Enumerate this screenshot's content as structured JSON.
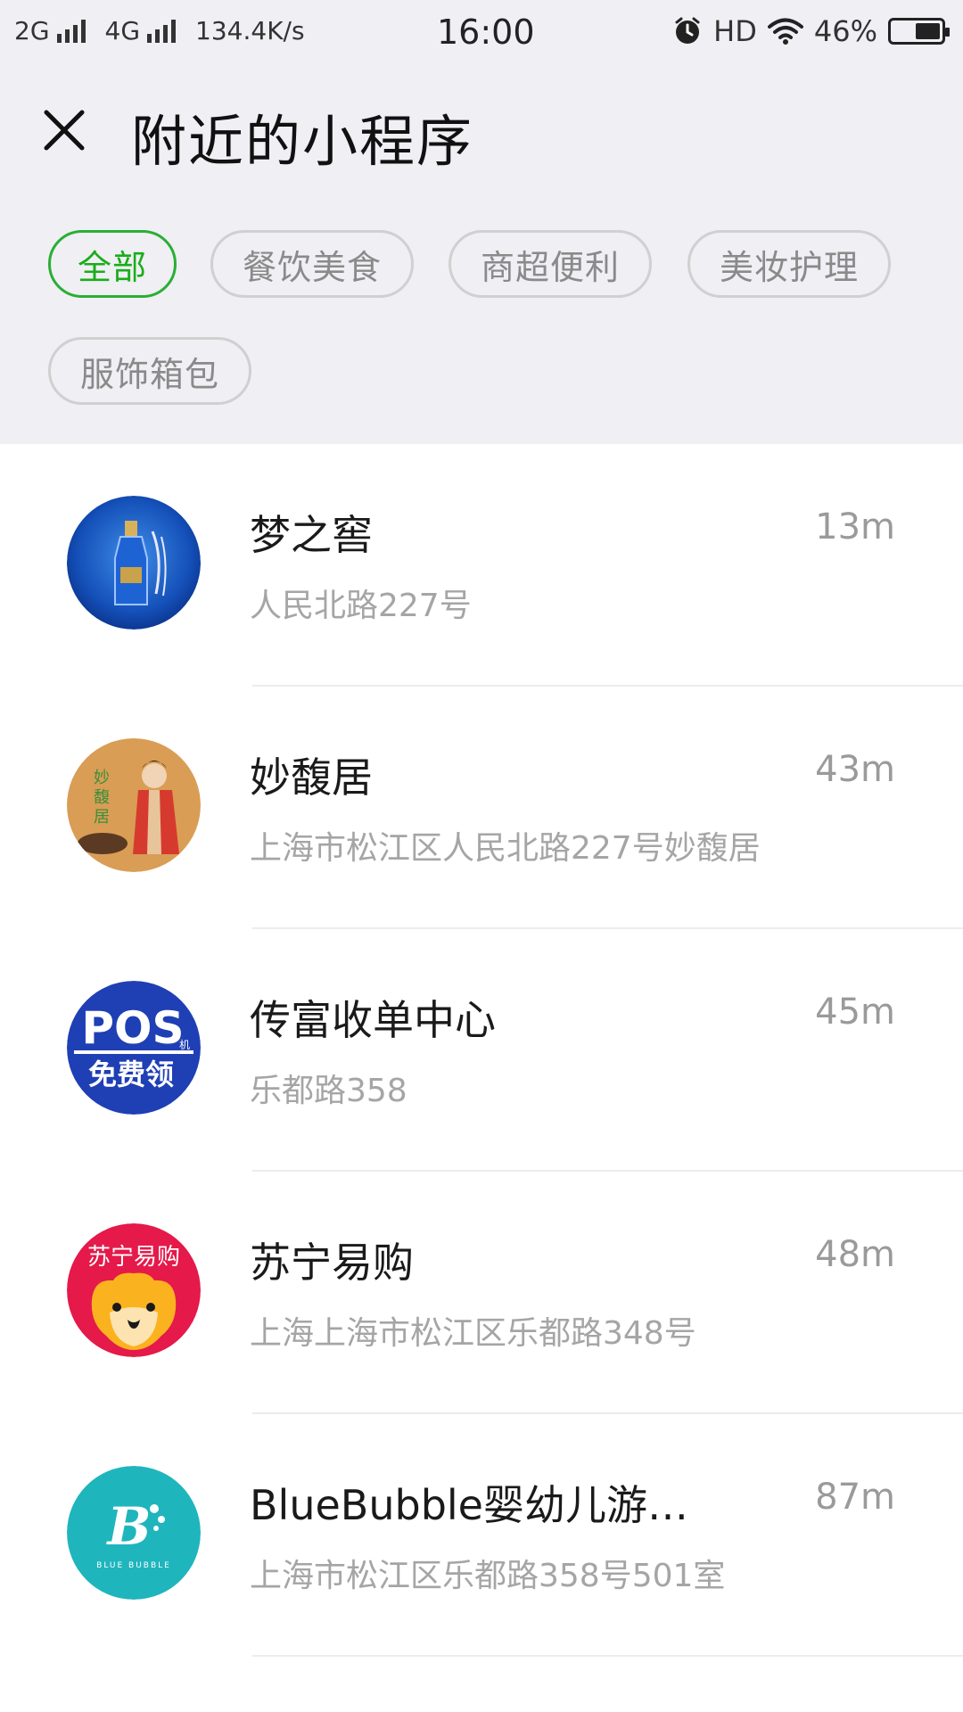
{
  "status_bar": {
    "net1": "2G",
    "net2": "4G",
    "speed": "134.4K/s",
    "time": "16:00",
    "hd": "HD",
    "battery": "46%",
    "battery_level": 0.46
  },
  "header": {
    "title": "附近的小程序",
    "close_icon": "close-icon"
  },
  "categories": [
    {
      "label": "全部",
      "active": true
    },
    {
      "label": "餐饮美食",
      "active": false
    },
    {
      "label": "商超便利",
      "active": false
    },
    {
      "label": "美妆护理",
      "active": false
    },
    {
      "label": "服饰箱包",
      "active": false
    }
  ],
  "items": [
    {
      "name": "梦之窖",
      "distance": "13m",
      "address": "人民北路227号",
      "icon": "mengzhijiao-logo"
    },
    {
      "name": "妙馥居",
      "distance": "43m",
      "address": "上海市松江区人民北路227号妙馥居",
      "icon": "miaofuju-logo"
    },
    {
      "name": "传富收单中心",
      "distance": "45m",
      "address": "乐都路358",
      "icon": "pos-logo",
      "logo_text_main": "POS",
      "logo_text_sub": "免费领",
      "logo_text_small": "机"
    },
    {
      "name": "苏宁易购",
      "distance": "48m",
      "address": "上海上海市松江区乐都路348号",
      "icon": "suning-logo",
      "logo_text": "苏宁易购"
    },
    {
      "name": "BlueBubble婴幼儿游…",
      "distance": "87m",
      "address": "上海市松江区乐都路358号501室",
      "icon": "bluebubble-logo",
      "logo_text": "BLUE BUBBLE"
    }
  ],
  "colors": {
    "accent": "#1aad19",
    "top_bg": "#efeff4"
  }
}
